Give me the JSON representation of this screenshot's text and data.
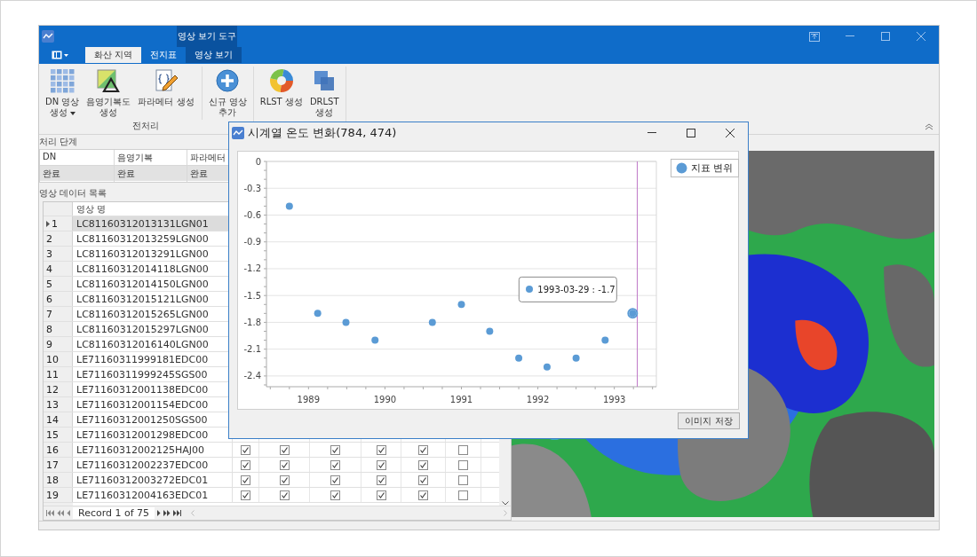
{
  "ribbon": {
    "context_group": "영상 보기 도구",
    "tabs": [
      {
        "label": "화산 지역",
        "selected": true,
        "contextual": false
      },
      {
        "label": "전지표",
        "selected": false,
        "contextual": false
      },
      {
        "label": "영상 보기",
        "selected": false,
        "contextual": true
      }
    ],
    "groups": [
      {
        "label": "전처리",
        "buttons": [
          {
            "kind": "grid",
            "lines": [
              "DN 영상",
              "생성"
            ],
            "dropdown": true,
            "separator_before": false
          },
          {
            "kind": "shade",
            "lines": [
              "음영기복도",
              "생성"
            ],
            "dropdown": false,
            "separator_before": false
          },
          {
            "kind": "script",
            "lines": [
              "파라메터 생성"
            ],
            "dropdown": false,
            "separator_before": false
          },
          {
            "kind": "add",
            "lines": [
              "신규 영상",
              "추가"
            ],
            "dropdown": false,
            "separator_before": true
          }
        ]
      },
      {
        "buttons": [
          {
            "kind": "ring",
            "lines": [
              "RLST 생성"
            ],
            "dropdown": false,
            "separator_before": false
          },
          {
            "kind": "layers",
            "lines": [
              "DRLST",
              "생성"
            ],
            "dropdown": false,
            "separator_before": false
          }
        ]
      }
    ]
  },
  "steps": {
    "label": "처리 단계",
    "columns": [
      "DN",
      "음영기복",
      "파라메터"
    ],
    "row": [
      "완료",
      "완료",
      "완료"
    ]
  },
  "table": {
    "label": "영상 데이터 목록",
    "columns": [
      "영상 명"
    ],
    "rows": [
      {
        "num": "1",
        "name": "LC81160312013131LGN01",
        "selected": true
      },
      {
        "num": "2",
        "name": "LC81160312013259LGN00",
        "selected": false
      },
      {
        "num": "3",
        "name": "LC81160312013291LGN00",
        "selected": false
      },
      {
        "num": "4",
        "name": "LC81160312014118LGN00",
        "selected": false
      },
      {
        "num": "5",
        "name": "LC81160312014150LGN00",
        "selected": false
      },
      {
        "num": "6",
        "name": "LC81160312015121LGN00",
        "selected": false
      },
      {
        "num": "7",
        "name": "LC81160312015265LGN00",
        "selected": false
      },
      {
        "num": "8",
        "name": "LC81160312015297LGN00",
        "selected": false
      },
      {
        "num": "9",
        "name": "LC81160312016140LGN00",
        "selected": false
      },
      {
        "num": "10",
        "name": "LE71160311999181EDC00",
        "selected": false
      },
      {
        "num": "11",
        "name": "LE71160311999245SGS00",
        "selected": false
      },
      {
        "num": "12",
        "name": "LE71160312001138EDC00",
        "selected": false
      },
      {
        "num": "13",
        "name": "LE71160312001154EDC00",
        "selected": false
      },
      {
        "num": "14",
        "name": "LE71160312001250SGS00",
        "selected": false
      },
      {
        "num": "15",
        "name": "LE71160312001298EDC00",
        "selected": false
      },
      {
        "num": "16",
        "name": "LE71160312002125HAJ00",
        "selected": false,
        "checks": [
          true,
          true,
          true,
          true,
          true,
          false
        ]
      },
      {
        "num": "17",
        "name": "LE71160312002237EDC00",
        "selected": false,
        "checks": [
          true,
          true,
          true,
          true,
          true,
          false
        ]
      },
      {
        "num": "18",
        "name": "LE71160312003272EDC01",
        "selected": false,
        "checks": [
          true,
          true,
          true,
          true,
          true,
          false
        ]
      },
      {
        "num": "19",
        "name": "LE71160312004163EDC01",
        "selected": false,
        "checks": [
          true,
          true,
          true,
          true,
          true,
          false
        ]
      }
    ],
    "record": "Record 1 of 75"
  },
  "dialog": {
    "title": "시계열 온도 변화(784, 474)",
    "save_button": "이미지 저장",
    "chart_data": {
      "type": "scatter",
      "x": [
        1988.75,
        1989.12,
        1989.49,
        1989.87,
        1990.62,
        1991.0,
        1991.37,
        1991.75,
        1992.12,
        1992.5,
        1992.88,
        1993.24
      ],
      "series": [
        {
          "name": "지표 변위",
          "color": "#5b9bd5",
          "values": [
            -0.5,
            -1.7,
            -1.8,
            -2.0,
            -1.8,
            -1.6,
            -1.9,
            -2.2,
            -2.3,
            -2.2,
            -2.0,
            -1.7
          ]
        }
      ],
      "grid": true,
      "xlim": [
        1988.45,
        1993.55
      ],
      "ylim": [
        -2.52,
        0
      ],
      "xticks": [
        1989,
        1990,
        1991,
        1992,
        1993
      ],
      "yticks": [
        0,
        -0.3,
        -0.6,
        -0.9,
        -1.2,
        -1.5,
        -1.8,
        -2.1,
        -2.4
      ],
      "ref_lines": [
        {
          "axis": "x",
          "value": 1993.3
        }
      ],
      "annotations": [
        {
          "text": "1993-03-29 : -1.7",
          "x": 1993.24,
          "y": -1.7
        }
      ]
    }
  }
}
